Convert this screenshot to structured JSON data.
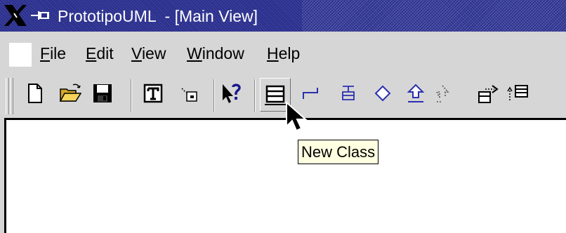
{
  "window": {
    "title": "PrototipoUML  - [Main View]",
    "title_bar_color": "#2a2f8e",
    "title_text_color": "#ffffff",
    "icons": [
      "x-logo-icon",
      "pin-icon"
    ]
  },
  "menubar": {
    "items": [
      {
        "mnemonic": "F",
        "rest": "ile"
      },
      {
        "mnemonic": "E",
        "rest": "dit"
      },
      {
        "mnemonic": "V",
        "rest": "iew"
      },
      {
        "mnemonic": "W",
        "rest": "indow"
      },
      {
        "mnemonic": "H",
        "rest": "elp"
      }
    ]
  },
  "toolbar": {
    "tools": [
      {
        "name": "new-file",
        "icon": "new-file-icon"
      },
      {
        "name": "open-folder",
        "icon": "open-folder-icon"
      },
      {
        "name": "save",
        "icon": "save-icon"
      },
      {
        "name": "text",
        "icon": "text-icon"
      },
      {
        "name": "small-box",
        "icon": "small-box-icon"
      },
      {
        "name": "context-help",
        "icon": "help-arrow-icon"
      },
      {
        "name": "new-class",
        "icon": "class-icon",
        "pressed": true
      },
      {
        "name": "association",
        "icon": "association-icon"
      },
      {
        "name": "dependency",
        "icon": "dependency-icon"
      },
      {
        "name": "diamond",
        "icon": "diamond-icon"
      },
      {
        "name": "generalization",
        "icon": "generalization-icon"
      },
      {
        "name": "dashed-generalization",
        "icon": "dashed-generalization-icon"
      },
      {
        "name": "package-arrow",
        "icon": "package-arrow-icon"
      },
      {
        "name": "note-arrow",
        "icon": "note-arrow-icon"
      }
    ]
  },
  "tooltip": {
    "text": "New Class",
    "background": "#ffffe1"
  },
  "colors": {
    "chrome": "#d6d6d6",
    "canvas": "#ffffff",
    "accent_blue": "#2a2f8e"
  }
}
